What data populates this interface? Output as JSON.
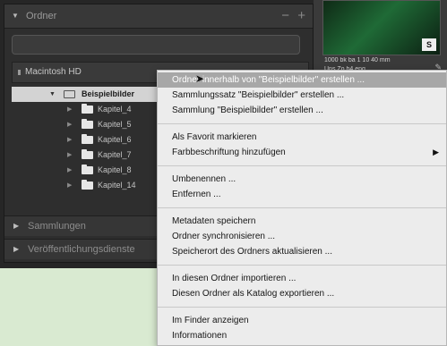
{
  "colors": {
    "menu_highlight": "#a7a7a7",
    "panel_bg": "#2e2e2e",
    "selected_row": "#d3d3d3",
    "page_bg": "#d9ead1"
  },
  "folders_panel": {
    "title": "Ordner",
    "remove_icon": "−",
    "add_icon": "+",
    "volume_label": "Macintosh HD",
    "tree": [
      {
        "label": "Beispielbilder",
        "selected": true,
        "level": 0
      },
      {
        "label": "Kapitel_4",
        "selected": false,
        "level": 1
      },
      {
        "label": "Kapitel_5",
        "selected": false,
        "level": 1
      },
      {
        "label": "Kapitel_6",
        "selected": false,
        "level": 1
      },
      {
        "label": "Kapitel_7",
        "selected": false,
        "level": 1
      },
      {
        "label": "Kapitel_8",
        "selected": false,
        "level": 1
      },
      {
        "label": "Kapitel_14",
        "selected": false,
        "level": 1
      }
    ],
    "sections": [
      "Sammlungen",
      "Veröffentlichungsdienste"
    ]
  },
  "filmstrip": {
    "thumb_badge": "S",
    "info_line_1": "1000 bk ba 1 10 40 mm",
    "info_line_2": "Uns Zo b4 eng"
  },
  "context_menu": {
    "items": [
      "Ordner innerhalb von \"Beispielbilder\" erstellen ...",
      "Sammlungssatz \"Beispielbilder\" erstellen ...",
      "Sammlung \"Beispielbilder\" erstellen ...",
      "Als Favorit markieren",
      "Farbbeschriftung hinzufügen",
      "Umbenennen ...",
      "Entfernen ...",
      "Metadaten speichern",
      "Ordner synchronisieren ...",
      "Speicherort des Ordners aktualisieren ...",
      "In diesen Ordner importieren ...",
      "Diesen Ordner als Katalog exportieren ...",
      "Im Finder anzeigen",
      "Informationen"
    ],
    "submenu_arrow": "▶"
  }
}
